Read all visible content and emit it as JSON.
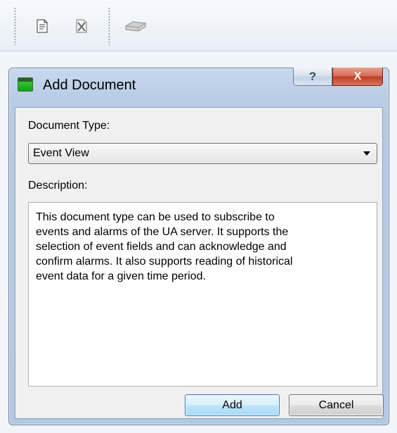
{
  "toolbar": {
    "items": [
      {
        "icon": "document-icon"
      },
      {
        "icon": "delete-document-icon"
      },
      {
        "icon": "disk-icon"
      }
    ]
  },
  "dialog": {
    "title": "Add Document",
    "help_label": "?",
    "close_label": "X",
    "document_type_label": "Document Type:",
    "document_type_value": "Event View",
    "description_label": "Description:",
    "description_lines": [
      "This document type can be used to subscribe to",
      "events and alarms of the UA server. It supports the",
      "selection of event fields and can acknowledge and",
      "confirm alarms. It also supports reading of historical",
      "event data for a given time period."
    ],
    "add_label": "Add",
    "cancel_label": "Cancel"
  },
  "colors": {
    "close_button": "#c0391f",
    "title_icon": "#14a214",
    "add_button_border": "#3c7fb1"
  }
}
